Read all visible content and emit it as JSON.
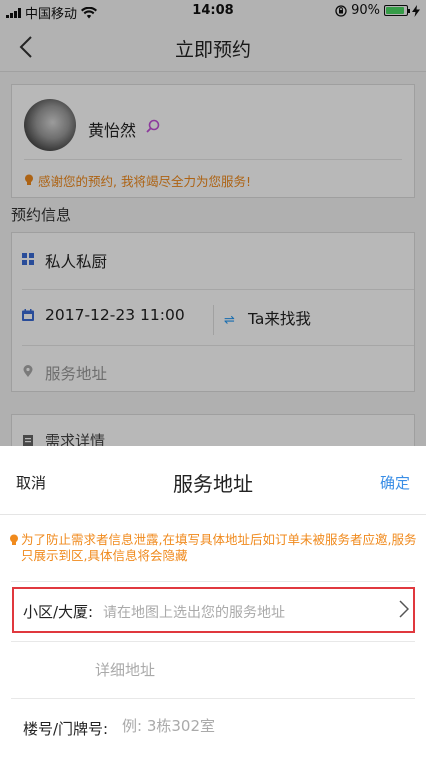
{
  "status_bar": {
    "carrier": "中国移动",
    "time": "14:08",
    "battery_percent": "90%",
    "battery_level": 0.9
  },
  "nav": {
    "title": "立即预约",
    "back_icon": "chevron-left-icon"
  },
  "profile": {
    "name": "黄怡然",
    "thanks_message": "感谢您的预约, 我将竭尽全力为您服务!"
  },
  "booking": {
    "section_title": "预约信息",
    "service": "私人私厨",
    "datetime": "2017-12-23 11:00",
    "visit_mode": "Ta来找我",
    "address_placeholder": "服务地址",
    "requirements": "需求详情"
  },
  "sheet": {
    "cancel_label": "取消",
    "title": "服务地址",
    "confirm_label": "确定",
    "warning": "为了防止需求者信息泄露,在填写具体地址后如订单未被服务者应邀,服务只展示到区,具体信息将会隐藏",
    "community_label": "小区/大厦:",
    "community_placeholder": "请在地图上选出您的服务地址",
    "detail_placeholder": "详细地址",
    "room_label": "楼号/门牌号:",
    "room_placeholder": "例: 3栋302室"
  },
  "colors": {
    "accent_blue": "#3a8ee6",
    "warning_orange": "#f08a1d",
    "highlight_red": "#e0383e"
  }
}
